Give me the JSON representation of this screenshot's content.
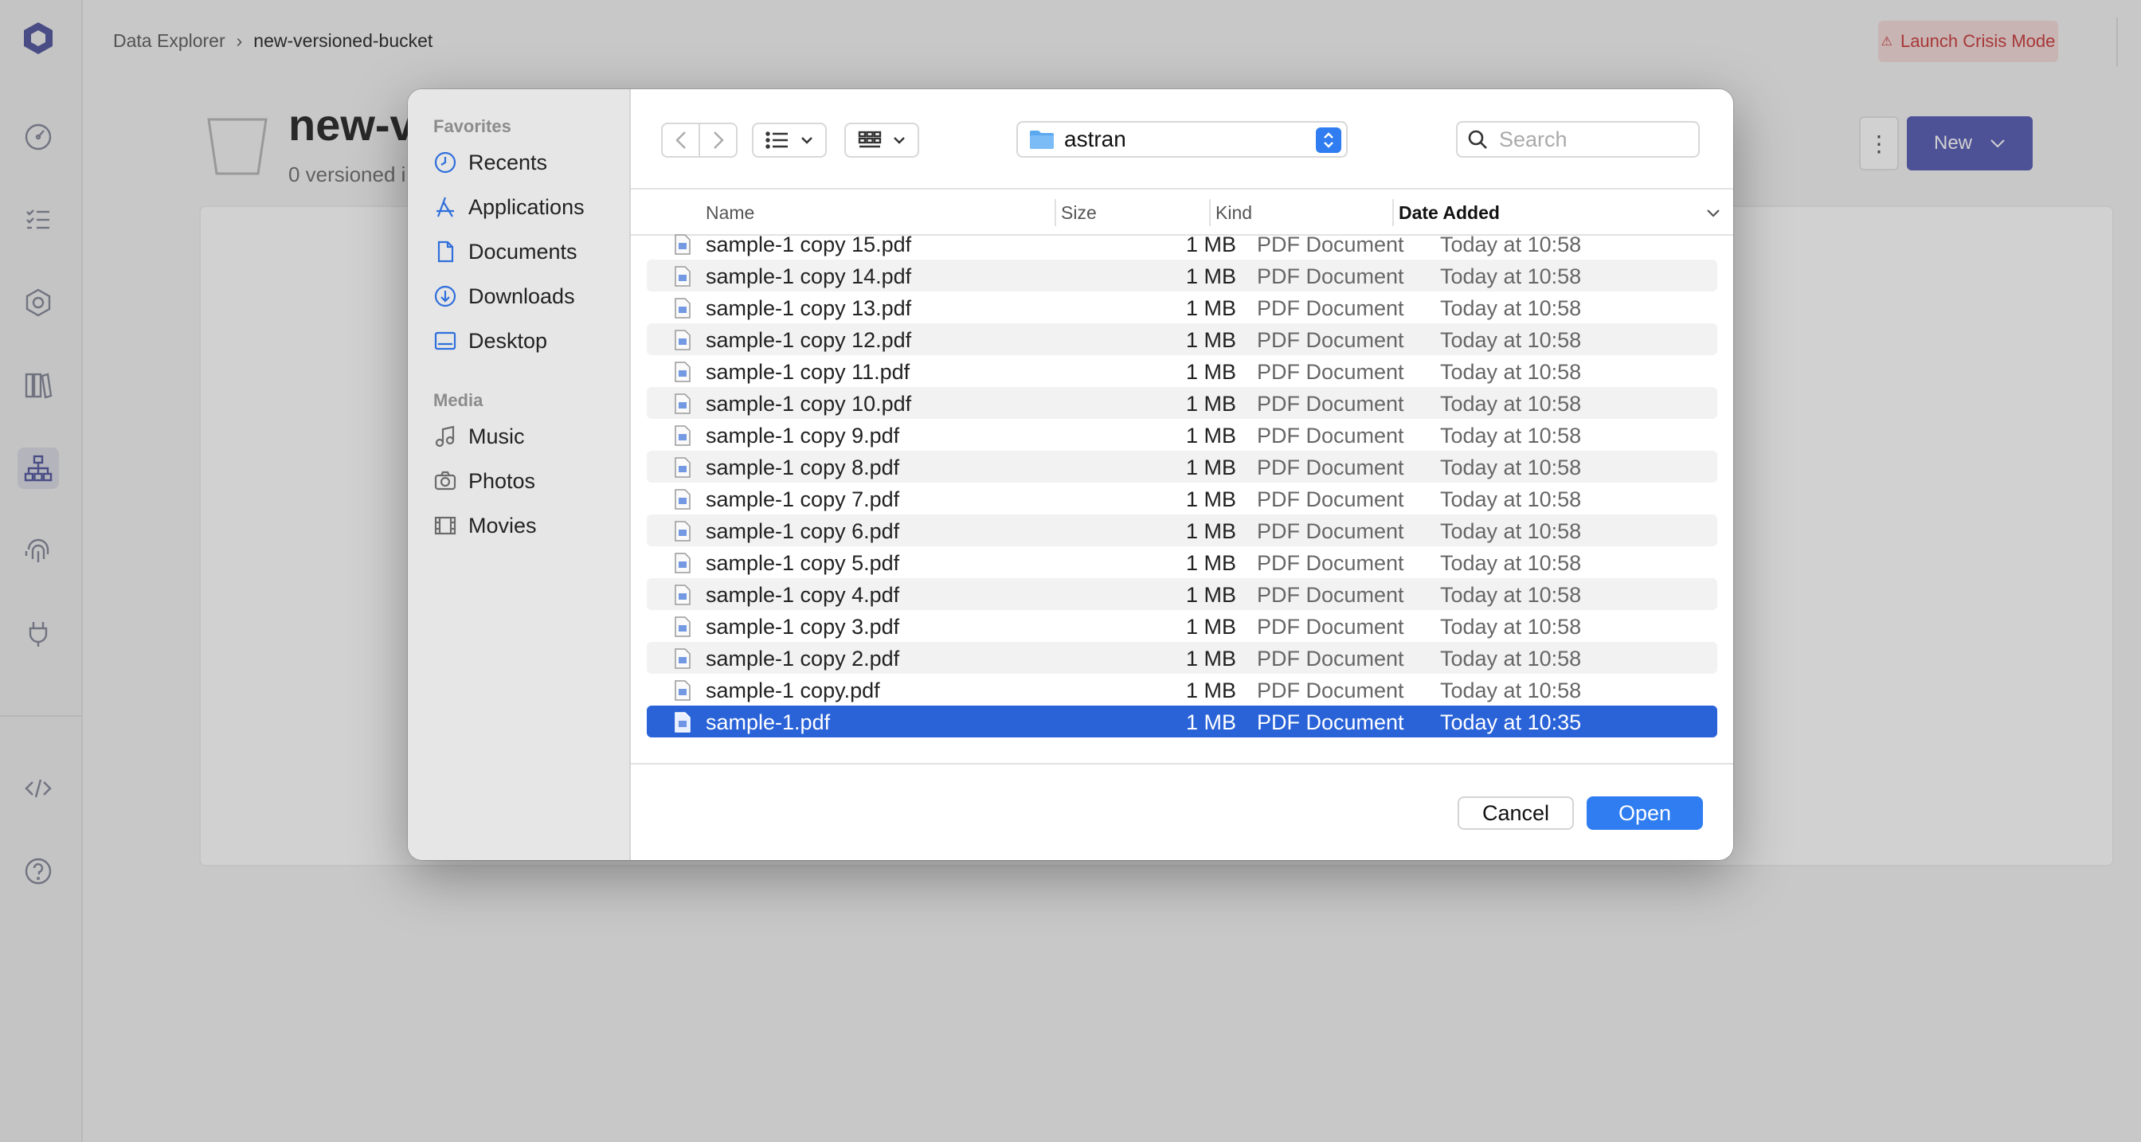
{
  "app": {
    "breadcrumb": [
      "Data Explorer",
      "new-versioned-bucket"
    ],
    "crisis_button": "Launch Crisis Mode",
    "bucket_title": "new-v",
    "bucket_subtitle": "0 versioned i",
    "new_button": "New",
    "more_button": "⋮",
    "sidebar_icons": [
      "brand-logo-icon",
      "dashboard-icon",
      "tasks-icon",
      "policies-icon",
      "library-icon",
      "data-explorer-icon",
      "fingerprint-icon",
      "plug-icon",
      "code-icon",
      "help-icon"
    ],
    "accent_color": "#5e63b8"
  },
  "dialog": {
    "sidebar": {
      "favorites_label": "Favorites",
      "favorites": [
        {
          "label": "Recents",
          "icon": "clock-icon"
        },
        {
          "label": "Applications",
          "icon": "applications-icon"
        },
        {
          "label": "Documents",
          "icon": "document-icon"
        },
        {
          "label": "Downloads",
          "icon": "download-icon"
        },
        {
          "label": "Desktop",
          "icon": "desktop-icon"
        }
      ],
      "media_label": "Media",
      "media": [
        {
          "label": "Music",
          "icon": "music-icon"
        },
        {
          "label": "Photos",
          "icon": "camera-icon"
        },
        {
          "label": "Movies",
          "icon": "film-icon"
        }
      ]
    },
    "toolbar": {
      "current_folder": "astran",
      "search_placeholder": "Search"
    },
    "columns": {
      "name": "Name",
      "size": "Size",
      "kind": "Kind",
      "date": "Date Added"
    },
    "files": [
      {
        "name": "sample-1 copy 15.pdf",
        "size": "1 MB",
        "kind": "PDF Document",
        "date": "Today at 10:58"
      },
      {
        "name": "sample-1 copy 14.pdf",
        "size": "1 MB",
        "kind": "PDF Document",
        "date": "Today at 10:58"
      },
      {
        "name": "sample-1 copy 13.pdf",
        "size": "1 MB",
        "kind": "PDF Document",
        "date": "Today at 10:58"
      },
      {
        "name": "sample-1 copy 12.pdf",
        "size": "1 MB",
        "kind": "PDF Document",
        "date": "Today at 10:58"
      },
      {
        "name": "sample-1 copy 11.pdf",
        "size": "1 MB",
        "kind": "PDF Document",
        "date": "Today at 10:58"
      },
      {
        "name": "sample-1 copy 10.pdf",
        "size": "1 MB",
        "kind": "PDF Document",
        "date": "Today at 10:58"
      },
      {
        "name": "sample-1 copy 9.pdf",
        "size": "1 MB",
        "kind": "PDF Document",
        "date": "Today at 10:58"
      },
      {
        "name": "sample-1 copy 8.pdf",
        "size": "1 MB",
        "kind": "PDF Document",
        "date": "Today at 10:58"
      },
      {
        "name": "sample-1 copy 7.pdf",
        "size": "1 MB",
        "kind": "PDF Document",
        "date": "Today at 10:58"
      },
      {
        "name": "sample-1 copy 6.pdf",
        "size": "1 MB",
        "kind": "PDF Document",
        "date": "Today at 10:58"
      },
      {
        "name": "sample-1 copy 5.pdf",
        "size": "1 MB",
        "kind": "PDF Document",
        "date": "Today at 10:58"
      },
      {
        "name": "sample-1 copy 4.pdf",
        "size": "1 MB",
        "kind": "PDF Document",
        "date": "Today at 10:58"
      },
      {
        "name": "sample-1 copy 3.pdf",
        "size": "1 MB",
        "kind": "PDF Document",
        "date": "Today at 10:58"
      },
      {
        "name": "sample-1 copy 2.pdf",
        "size": "1 MB",
        "kind": "PDF Document",
        "date": "Today at 10:58"
      },
      {
        "name": "sample-1 copy.pdf",
        "size": "1 MB",
        "kind": "PDF Document",
        "date": "Today at 10:58"
      },
      {
        "name": "sample-1.pdf",
        "size": "1 MB",
        "kind": "PDF Document",
        "date": "Today at 10:35",
        "selected": true
      }
    ],
    "cancel_button": "Cancel",
    "open_button": "Open",
    "selection_color": "#2a63d8",
    "primary_color": "#2f7df0"
  }
}
